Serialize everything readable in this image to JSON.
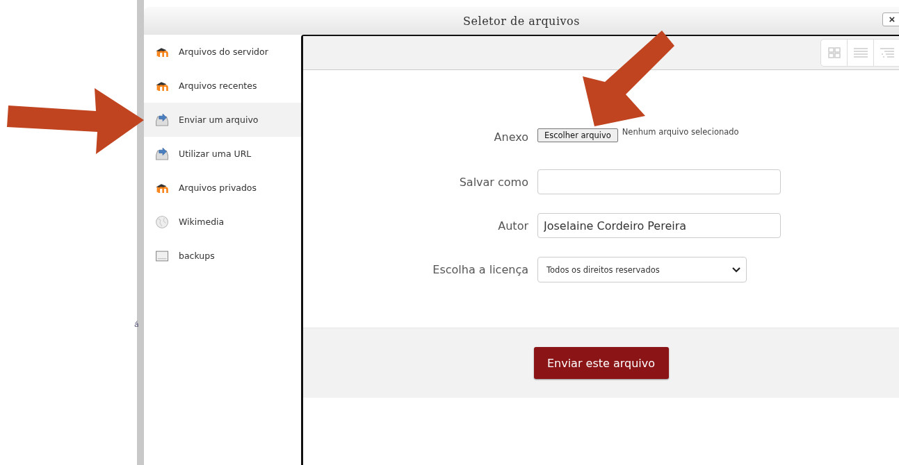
{
  "background_fragment": "á",
  "dialog": {
    "title": "Seletor de arquivos",
    "close": "×"
  },
  "sidebar": {
    "items": [
      {
        "label": "Arquivos do servidor",
        "kind": "moodle",
        "selected": false
      },
      {
        "label": "Arquivos recentes",
        "kind": "moodle",
        "selected": false
      },
      {
        "label": "Enviar um arquivo",
        "kind": "upload",
        "selected": true
      },
      {
        "label": "Utilizar uma URL",
        "kind": "upload",
        "selected": false
      },
      {
        "label": "Arquivos privados",
        "kind": "moodle",
        "selected": false
      },
      {
        "label": "Wikimedia",
        "kind": "wiki",
        "selected": false
      },
      {
        "label": "backups",
        "kind": "folder",
        "selected": false
      }
    ]
  },
  "form": {
    "fields": [
      {
        "kind": "file",
        "label": "Anexo",
        "button": "Escolher arquivo",
        "status": "Nenhum arquivo selecionado"
      },
      {
        "kind": "text",
        "label": "Salvar como"
      },
      {
        "kind": "text",
        "label": "Autor",
        "value": "Joselaine Cordeiro Pereira"
      },
      {
        "kind": "select",
        "label": "Escolha a licença",
        "value": "Todos os direitos reservados"
      }
    ],
    "submit": "Enviar este arquivo"
  }
}
